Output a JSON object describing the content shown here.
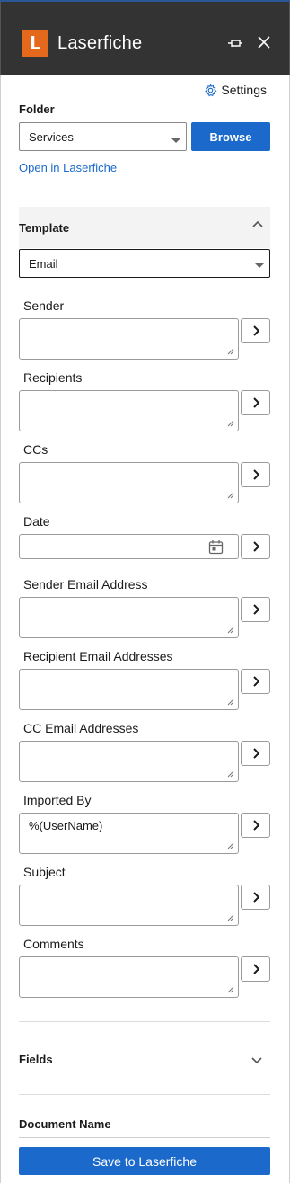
{
  "app": {
    "title": "Laserfiche",
    "logo_letter": "L"
  },
  "settings_label": "Settings",
  "folder": {
    "label": "Folder",
    "value": "Services",
    "browse_label": "Browse",
    "open_link": "Open in Laserfiche"
  },
  "template": {
    "label": "Template",
    "value": "Email"
  },
  "fields": [
    {
      "label": "Sender",
      "value": ""
    },
    {
      "label": "Recipients",
      "value": ""
    },
    {
      "label": "CCs",
      "value": ""
    },
    {
      "label": "Date",
      "value": ""
    },
    {
      "label": "Sender Email Address",
      "value": ""
    },
    {
      "label": "Recipient Email Addresses",
      "value": ""
    },
    {
      "label": "CC Email Addresses",
      "value": ""
    },
    {
      "label": "Imported By",
      "value": "%(UserName)"
    },
    {
      "label": "Subject",
      "value": ""
    },
    {
      "label": "Comments",
      "value": ""
    }
  ],
  "fields_section_label": "Fields",
  "document_name_label": "Document Name",
  "save_label": "Save to Laserfiche",
  "colors": {
    "accent": "#1b6acb",
    "titlebar": "#333333",
    "logo": "#e5691d"
  },
  "icons": [
    "pin-icon",
    "close-icon",
    "gear-icon",
    "calendar-icon",
    "chevron-right-icon",
    "chevron-up-icon",
    "chevron-down-icon"
  ]
}
